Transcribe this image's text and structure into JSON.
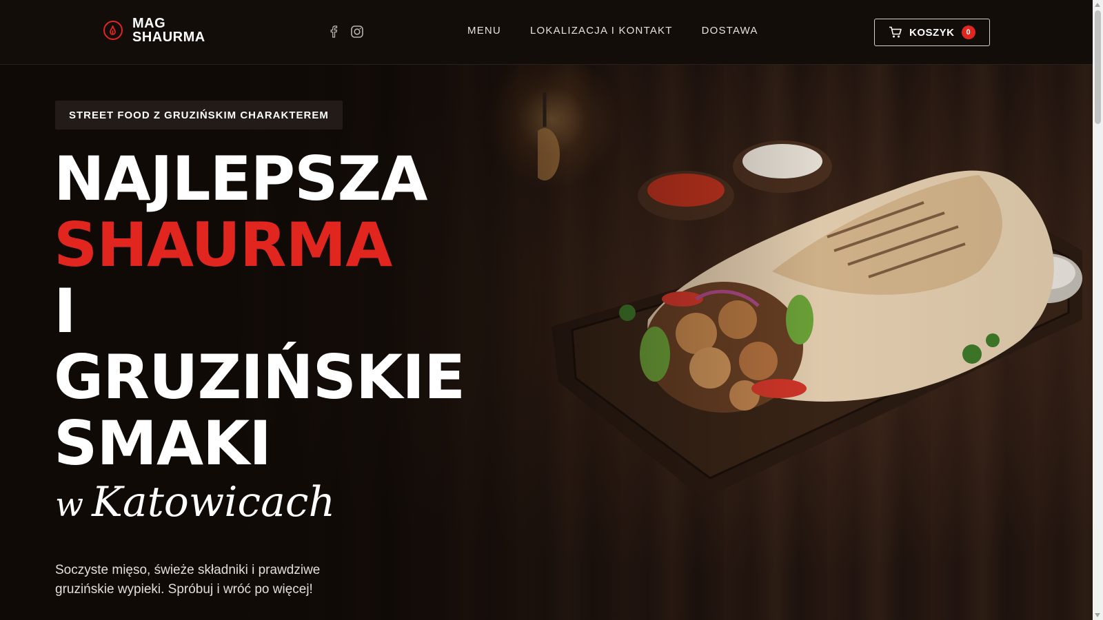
{
  "header": {
    "brand": {
      "line1": "MAG",
      "line2": "SHAURMA",
      "icon": "logo-flame-icon"
    },
    "socials": [
      {
        "icon": "facebook-icon"
      },
      {
        "icon": "instagram-icon"
      }
    ],
    "nav": [
      {
        "label": "MENU"
      },
      {
        "label": "LOKALIZACJA I KONTAKT"
      },
      {
        "label": "DOSTAWA"
      }
    ],
    "cart": {
      "label": "KOSZYK",
      "count": "0",
      "icon": "cart-icon"
    }
  },
  "hero": {
    "tagline": "STREET FOOD Z GRUZIŃSKIM CHARAKTEREM",
    "headline": {
      "line1": "NAJLEPSZA",
      "line2": "SHAURMA",
      "line3": "I",
      "line4": "GRUZIŃSKIE",
      "line5": "SMAKI"
    },
    "script": {
      "prefix": "w",
      "city": "Katowicach"
    },
    "description": "Soczyste mięso, świeże składniki i prawdziwe gruzińskie wypieki. Spróbuj i wróć po więcej!"
  },
  "colors": {
    "accent": "#e0261f",
    "background": "#130d0a"
  }
}
